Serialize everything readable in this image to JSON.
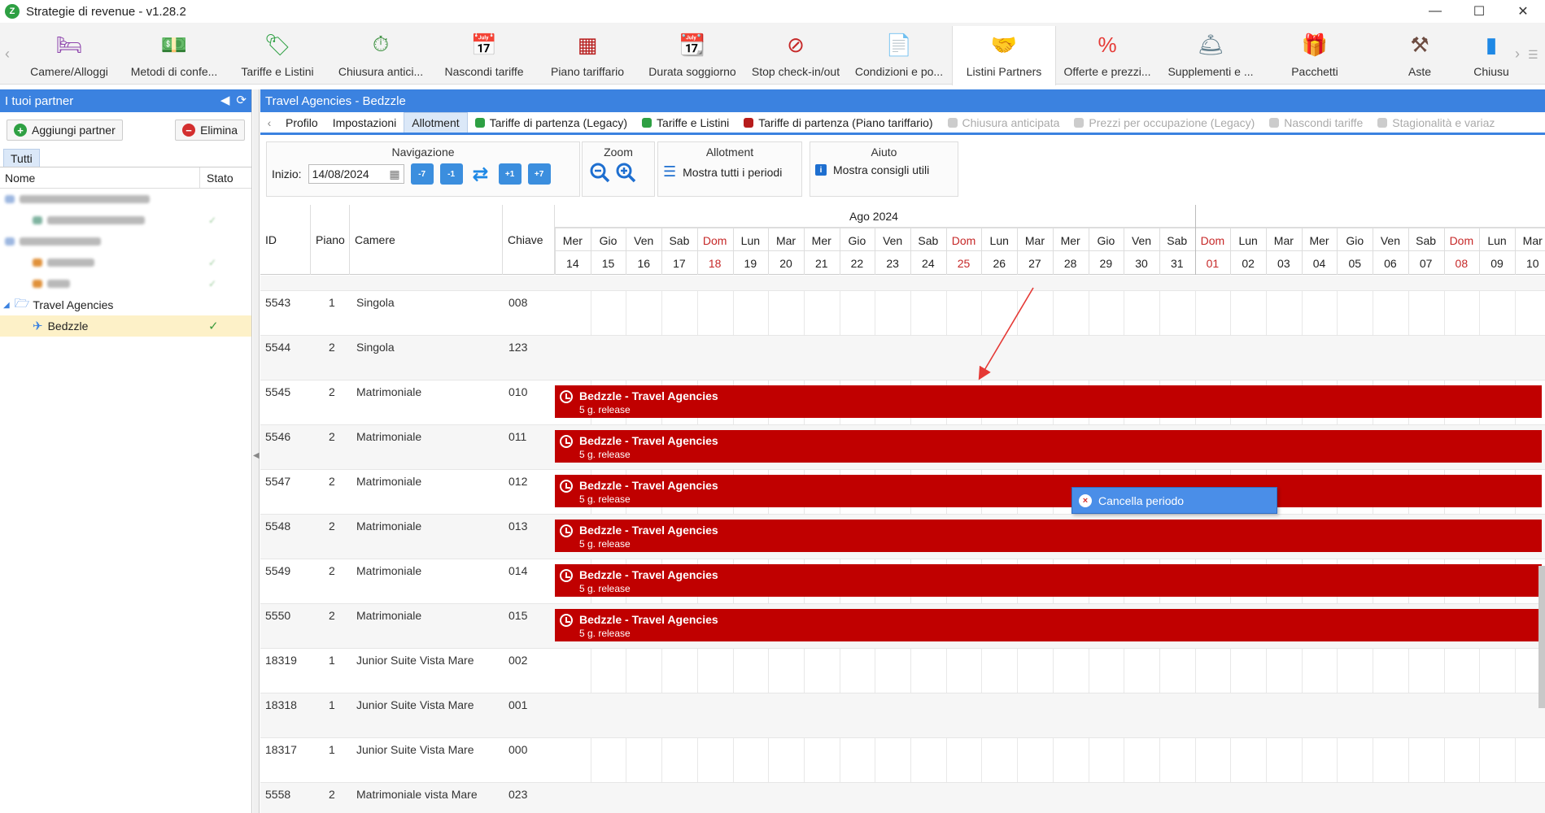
{
  "window": {
    "title": "Strategie di revenue - v1.28.2",
    "logo_text": "Z",
    "controls": [
      "—",
      "☐",
      "✕"
    ]
  },
  "ribbon": {
    "items": [
      {
        "label": "Camere/Alloggi",
        "icon": "bed-icon",
        "glyph": "🛏",
        "color": "#8e44ad"
      },
      {
        "label": "Metodi di confe...",
        "icon": "cash-icon",
        "glyph": "💵",
        "color": "#2e7d32"
      },
      {
        "label": "Tariffe e Listini",
        "icon": "price-tag-icon",
        "glyph": "🏷",
        "color": "#2ea043"
      },
      {
        "label": "Chiusura antici...",
        "icon": "stopwatch-lock-icon",
        "glyph": "⏱",
        "color": "#388e3c"
      },
      {
        "label": "Nascondi tariffe",
        "icon": "calendar-hide-icon",
        "glyph": "📅",
        "color": "#666666"
      },
      {
        "label": "Piano tariffario",
        "icon": "calendar-grid-icon",
        "glyph": "▦",
        "color": "#b71c1c"
      },
      {
        "label": "Durata soggiorno",
        "icon": "calendar-ruler-icon",
        "glyph": "📆",
        "color": "#1e88e5"
      },
      {
        "label": "Stop check-in/out",
        "icon": "calendar-stop-icon",
        "glyph": "⊘",
        "color": "#c62828"
      },
      {
        "label": "Condizioni e po...",
        "icon": "document-icon",
        "glyph": "📄",
        "color": "#1e88e5"
      },
      {
        "label": "Listini Partners",
        "icon": "handshake-icon",
        "glyph": "🤝",
        "color": "#e08a2b"
      },
      {
        "label": "Offerte e prezzi...",
        "icon": "discount-icon",
        "glyph": "%",
        "color": "#e53935"
      },
      {
        "label": "Supplementi e ...",
        "icon": "service-bell-icon",
        "glyph": "🛎",
        "color": "#607d8b"
      },
      {
        "label": "Pacchetti",
        "icon": "gift-icon",
        "glyph": "🎁",
        "color": "#e53935"
      },
      {
        "label": "Aste",
        "icon": "gavel-icon",
        "glyph": "⚒",
        "color": "#6d4c41"
      },
      {
        "label": "Chiusu",
        "icon": "calendar-close-icon",
        "glyph": "▮",
        "color": "#1e88e5"
      }
    ],
    "active_index": 9,
    "prev_arrow": "‹",
    "next_arrow": "›",
    "menu_glyph": "☰"
  },
  "left_panel": {
    "title": "I tuoi partner",
    "collapse_glyph": "◀",
    "refresh_glyph": "⟳",
    "add_button": "Aggiungi partner",
    "delete_button": "Elimina",
    "tab": "Tutti",
    "col_name": "Nome",
    "col_status": "Stato",
    "tree": {
      "group_label": "Travel Agencies",
      "child_label": "Bedzzle",
      "child_status": "✓"
    }
  },
  "main": {
    "title": "Travel Agencies - Bedzzle",
    "tabs": [
      {
        "label": "Profilo",
        "state": "normal",
        "icon": ""
      },
      {
        "label": "Impostazioni",
        "state": "normal",
        "icon": ""
      },
      {
        "label": "Allotment",
        "state": "active",
        "icon": ""
      },
      {
        "label": "Tariffe di partenza (Legacy)",
        "state": "normal",
        "icon": "tag-icon",
        "color": "#2ea043"
      },
      {
        "label": "Tariffe e Listini",
        "state": "normal",
        "icon": "tag-icon",
        "color": "#2ea043"
      },
      {
        "label": "Tariffe di partenza (Piano tariffario)",
        "state": "normal",
        "icon": "grid-icon",
        "color": "#b71c1c"
      },
      {
        "label": "Chiusura anticipata",
        "state": "disabled",
        "icon": "stopwatch-icon",
        "color": "#cccccc"
      },
      {
        "label": "Prezzi per occupazione (Legacy)",
        "state": "disabled",
        "icon": "chart-icon",
        "color": "#cccccc"
      },
      {
        "label": "Nascondi tariffe",
        "state": "disabled",
        "icon": "calendar-hide-icon",
        "color": "#cccccc"
      },
      {
        "label": "Stagionalità e variaz",
        "state": "disabled",
        "icon": "calendar-icon",
        "color": "#cccccc"
      }
    ],
    "toolbar": {
      "nav_title": "Navigazione",
      "start_label": "Inizio:",
      "start_date": "14/08/2024",
      "nav_buttons": [
        "-7",
        "-1",
        "⇄",
        "+1",
        "+7"
      ],
      "zoom_title": "Zoom",
      "zoom_out": "−",
      "zoom_in": "+",
      "allotment_title": "Allotment",
      "show_all": "Mostra tutti i periodi",
      "help_title": "Aiuto",
      "show_tips": "Mostra consigli utili",
      "info_glyph": "i"
    },
    "grid": {
      "headers": {
        "id": "ID",
        "floor": "Piano",
        "room": "Camere",
        "key": "Chiave"
      },
      "month_label": "Ago 2024",
      "days": [
        {
          "wd": "Mer",
          "d": "14",
          "sun": false
        },
        {
          "wd": "Gio",
          "d": "15",
          "sun": false
        },
        {
          "wd": "Ven",
          "d": "16",
          "sun": false
        },
        {
          "wd": "Sab",
          "d": "17",
          "sun": false
        },
        {
          "wd": "Dom",
          "d": "18",
          "sun": true
        },
        {
          "wd": "Lun",
          "d": "19",
          "sun": false
        },
        {
          "wd": "Mar",
          "d": "20",
          "sun": false
        },
        {
          "wd": "Mer",
          "d": "21",
          "sun": false
        },
        {
          "wd": "Gio",
          "d": "22",
          "sun": false
        },
        {
          "wd": "Ven",
          "d": "23",
          "sun": false
        },
        {
          "wd": "Sab",
          "d": "24",
          "sun": false
        },
        {
          "wd": "Dom",
          "d": "25",
          "sun": true
        },
        {
          "wd": "Lun",
          "d": "26",
          "sun": false
        },
        {
          "wd": "Mar",
          "d": "27",
          "sun": false
        },
        {
          "wd": "Mer",
          "d": "28",
          "sun": false
        },
        {
          "wd": "Gio",
          "d": "29",
          "sun": false
        },
        {
          "wd": "Ven",
          "d": "30",
          "sun": false
        },
        {
          "wd": "Sab",
          "d": "31",
          "sun": false
        },
        {
          "wd": "Dom",
          "d": "01",
          "sun": true
        },
        {
          "wd": "Lun",
          "d": "02",
          "sun": false
        },
        {
          "wd": "Mar",
          "d": "03",
          "sun": false
        },
        {
          "wd": "Mer",
          "d": "04",
          "sun": false
        },
        {
          "wd": "Gio",
          "d": "05",
          "sun": false
        },
        {
          "wd": "Ven",
          "d": "06",
          "sun": false
        },
        {
          "wd": "Sab",
          "d": "07",
          "sun": false
        },
        {
          "wd": "Dom",
          "d": "08",
          "sun": true
        },
        {
          "wd": "Lun",
          "d": "09",
          "sun": false
        },
        {
          "wd": "Mar",
          "d": "10",
          "sun": false
        }
      ],
      "rows": [
        {
          "id": "5543",
          "floor": "1",
          "room": "Singola",
          "key": "008",
          "allotment": false
        },
        {
          "id": "5544",
          "floor": "2",
          "room": "Singola",
          "key": "123",
          "allotment": false
        },
        {
          "id": "5545",
          "floor": "2",
          "room": "Matrimoniale",
          "key": "010",
          "allotment": true
        },
        {
          "id": "5546",
          "floor": "2",
          "room": "Matrimoniale",
          "key": "011",
          "allotment": true
        },
        {
          "id": "5547",
          "floor": "2",
          "room": "Matrimoniale",
          "key": "012",
          "allotment": true
        },
        {
          "id": "5548",
          "floor": "2",
          "room": "Matrimoniale",
          "key": "013",
          "allotment": true
        },
        {
          "id": "5549",
          "floor": "2",
          "room": "Matrimoniale",
          "key": "014",
          "allotment": true
        },
        {
          "id": "5550",
          "floor": "2",
          "room": "Matrimoniale",
          "key": "015",
          "allotment": true
        },
        {
          "id": "18319",
          "floor": "1",
          "room": "Junior Suite Vista Mare",
          "key": "002",
          "allotment": false
        },
        {
          "id": "18318",
          "floor": "1",
          "room": "Junior Suite Vista Mare",
          "key": "001",
          "allotment": false
        },
        {
          "id": "18317",
          "floor": "1",
          "room": "Junior Suite Vista Mare",
          "key": "000",
          "allotment": false
        },
        {
          "id": "5558",
          "floor": "2",
          "room": "Matrimoniale vista Mare",
          "key": "023",
          "allotment": false
        }
      ],
      "bar_title": "Bedzzle - Travel Agencies",
      "bar_subtitle": "5 g. release",
      "bar_color": "#c00000"
    },
    "context_menu": {
      "label": "Cancella periodo",
      "icon_glyph": "×"
    }
  }
}
